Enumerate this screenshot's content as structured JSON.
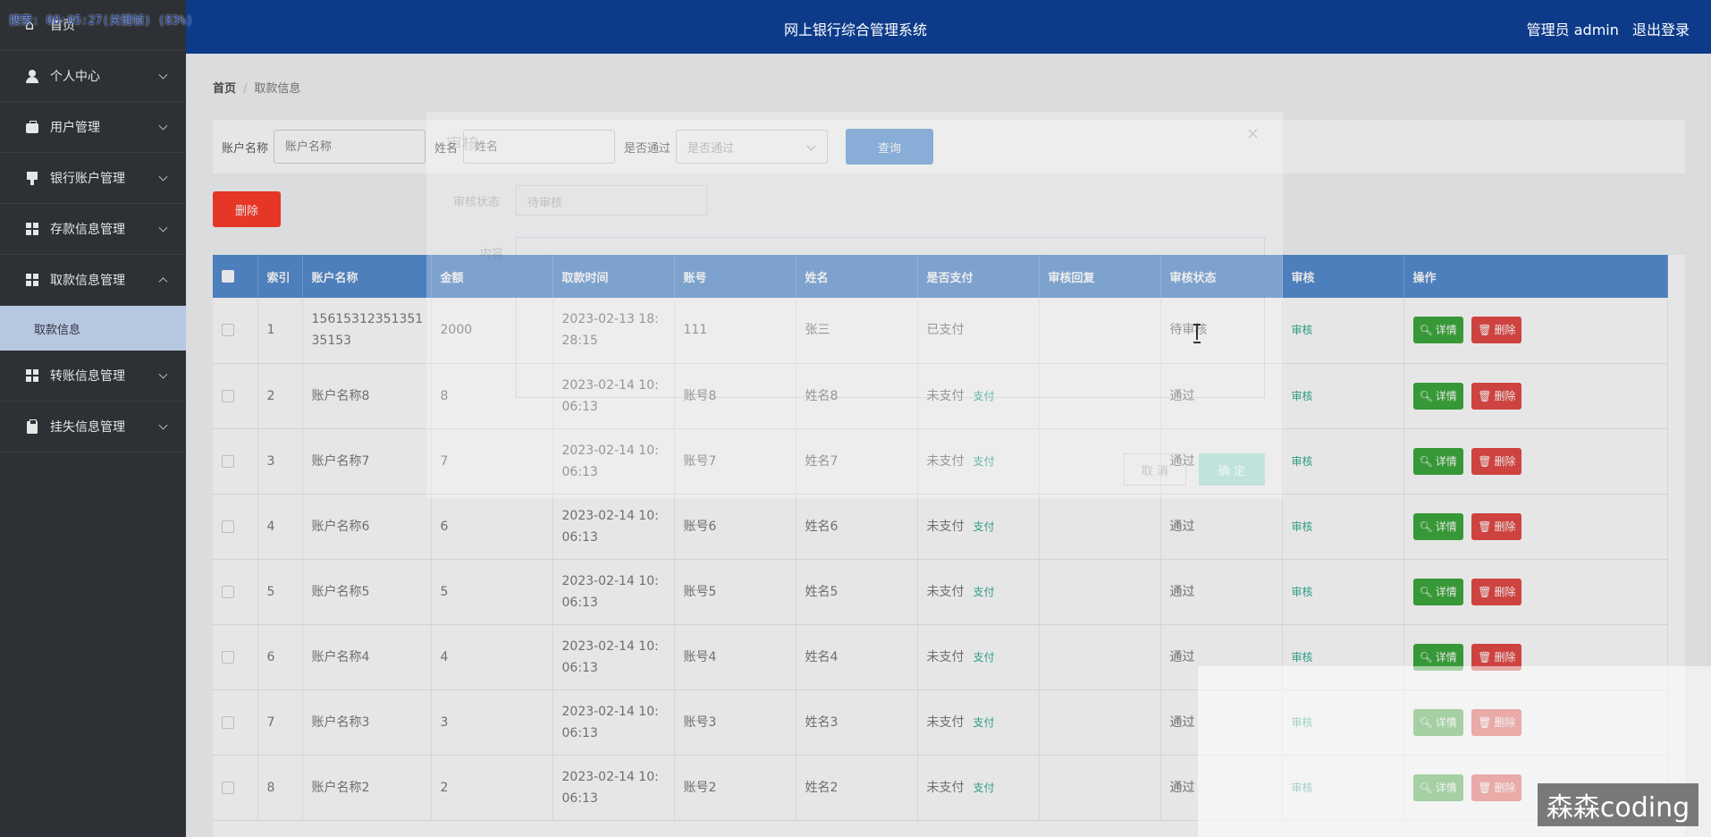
{
  "recording": {
    "text": "搜索: 00:05:27(关键帧) (83%)"
  },
  "header": {
    "title": "网上银行综合管理系统",
    "user": "管理员 admin",
    "logout": "退出登录"
  },
  "sidebar": {
    "items": [
      {
        "label": "首页",
        "icon": "home-icon"
      },
      {
        "label": "个人中心",
        "icon": "user-icon"
      },
      {
        "label": "用户管理",
        "icon": "briefcase-icon"
      },
      {
        "label": "银行账户管理",
        "icon": "card-icon"
      },
      {
        "label": "存款信息管理",
        "icon": "grid-icon"
      },
      {
        "label": "取款信息管理",
        "icon": "grid-icon"
      },
      {
        "label": "转账信息管理",
        "icon": "grid-icon"
      },
      {
        "label": "挂失信息管理",
        "icon": "clipboard-icon"
      }
    ],
    "sub_item": "取款信息"
  },
  "breadcrumb": {
    "home": "首页",
    "sep": "/",
    "current": "取款信息"
  },
  "search": {
    "account_label": "账户名称",
    "account_placeholder": "账户名称",
    "name_label": "姓名",
    "name_placeholder": "姓名",
    "pass_label": "是否通过",
    "pass_placeholder": "是否通过",
    "query_button": "查询"
  },
  "delete_button": "删除",
  "table": {
    "headers": [
      "索引",
      "账户名称",
      "金额",
      "取款时间",
      "账号",
      "姓名",
      "是否支付",
      "审核回复",
      "审核状态",
      "审核",
      "操作"
    ],
    "pay_link": "支付",
    "audit_link": "审核",
    "detail_button": "详情",
    "delete_button": "删除",
    "rows": [
      {
        "index": "1",
        "account": "1561531235135135153",
        "amount": "2000",
        "time": "2023-02-13 18:28:15",
        "acct_no": "111",
        "name": "张三",
        "paid": "已支付",
        "reply": "",
        "status": "待审核"
      },
      {
        "index": "2",
        "account": "账户名称8",
        "amount": "8",
        "time": "2023-02-14 10:06:13",
        "acct_no": "账号8",
        "name": "姓名8",
        "paid": "未支付",
        "reply": "",
        "status": "通过"
      },
      {
        "index": "3",
        "account": "账户名称7",
        "amount": "7",
        "time": "2023-02-14 10:06:13",
        "acct_no": "账号7",
        "name": "姓名7",
        "paid": "未支付",
        "reply": "",
        "status": "通过"
      },
      {
        "index": "4",
        "account": "账户名称6",
        "amount": "6",
        "time": "2023-02-14 10:06:13",
        "acct_no": "账号6",
        "name": "姓名6",
        "paid": "未支付",
        "reply": "",
        "status": "通过"
      },
      {
        "index": "5",
        "account": "账户名称5",
        "amount": "5",
        "time": "2023-02-14 10:06:13",
        "acct_no": "账号5",
        "name": "姓名5",
        "paid": "未支付",
        "reply": "",
        "status": "通过"
      },
      {
        "index": "6",
        "account": "账户名称4",
        "amount": "4",
        "time": "2023-02-14 10:06:13",
        "acct_no": "账号4",
        "name": "姓名4",
        "paid": "未支付",
        "reply": "",
        "status": "通过"
      },
      {
        "index": "7",
        "account": "账户名称3",
        "amount": "3",
        "time": "2023-02-14 10:06:13",
        "acct_no": "账号3",
        "name": "姓名3",
        "paid": "未支付",
        "reply": "",
        "status": "通过"
      },
      {
        "index": "8",
        "account": "账户名称2",
        "amount": "2",
        "time": "2023-02-14 10:06:13",
        "acct_no": "账号2",
        "name": "姓名2",
        "paid": "未支付",
        "reply": "",
        "status": "通过"
      }
    ]
  },
  "dialog": {
    "title": "审核",
    "close": "×",
    "status_label": "审核状态",
    "status_value": "待审核",
    "reply_label": "内容",
    "cancel": "取 消",
    "confirm": "确 定"
  },
  "watermark": "森森coding",
  "colors": {
    "header": "#0d3b8a",
    "sidebar": "#2d3035",
    "table_header": "#3a7bc8",
    "delete": "#ff1e0a",
    "detail": "#1e9c1e",
    "link": "#12a182"
  }
}
